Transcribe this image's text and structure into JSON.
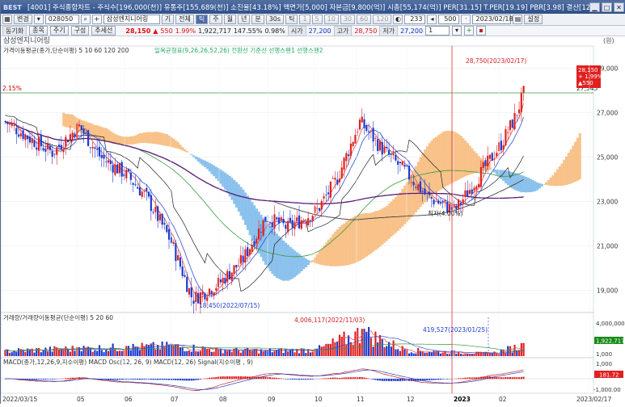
{
  "titlebar": {
    "logo": "BEST",
    "title": "[4001] 주식종합차트 - 주식수[196,000(천)] 유통주[155,689(천)] 소진율[43.18%] 액면가[5,000] 자본금[9,800(억)] 시총[55,174(억)] PER[31.15] T.PER[19.19] PBR[3.98] 결산[12월]"
  },
  "toolbar": {
    "market": "변경",
    "code": "028050",
    "name": "삼성엔지니어링",
    "period_buttons": [
      "기",
      "전체",
      "틱",
      "주",
      "월",
      "년",
      "분",
      "30s",
      "틱"
    ],
    "minute_buttons": [
      "1",
      "5",
      "10",
      "30",
      "60",
      "120"
    ],
    "count": "233",
    "max_count": "500",
    "date": "2023/02/18",
    "save": "설정"
  },
  "quotebar": {
    "sync": "동기화",
    "tabs": [
      "종목",
      "주기",
      "구성",
      "추세선"
    ],
    "name": "삼성엔지니어링",
    "price": "28,150",
    "arrow": "▲",
    "change": "550",
    "change_pct": "1.99%",
    "volume": "1,922,717",
    "vol_ratio": "147.55%",
    "turnover": "0.98%",
    "open_label": "시가",
    "open": "27,200",
    "high_label": "고가",
    "high": "28,750",
    "low_label": "저가",
    "low": "27,200",
    "page": "1"
  },
  "panels": {
    "price_title": "삼성엔지니어링",
    "price_unit": "(원)",
    "ma_legend": "가격이동평균(종가,단순이평) 5 10 60 120 200",
    "ichimoku_legend": "일목균형표(9,26,26,52,26) 전환선 기준선 선행스팬1 선행스팬2",
    "volume_legend": "거래량/거래량이동평균(단순이평) 5 20 60",
    "macd_legend": "MACD(종가,12,26,9,지수이평) MACD Osc(12, 26, 9) MACD(12, 26) Signal(지수이평 , 9)",
    "high_annotation": "28,750(2023/02/17)",
    "low_annotation": "18,450(2022/07/15)",
    "pct_annotation": "2.15%",
    "line_label": "27,545",
    "low_pct_annotation": "최저(4.00%)",
    "vol_high_annotation": "4,006,117(2022/11/03)",
    "vol_mid_annotation": "419,527(2023/01/25)",
    "price_tag": {
      "price": "28,150",
      "change": "+ 1.99%",
      "diff": "▲550"
    },
    "vol_tag": "1,922,717",
    "vol_axis": [
      "4,000,000",
      "1,000"
    ],
    "macd_tag": "181.72",
    "macd_axis": [
      "1,000",
      "-1,000.00"
    ],
    "price_axis": [
      "29,000",
      "27,000",
      "25,000",
      "23,000",
      "21,000",
      "19,000"
    ],
    "x_axis": [
      "2022/03/15",
      "05",
      "06",
      "07",
      "08",
      "09",
      "10",
      "11",
      "12",
      "2023",
      "02",
      "2023/02/17"
    ]
  },
  "chart_data": [
    {
      "type": "line",
      "title": "삼성엔지니어링",
      "ylabel": "(원)",
      "ylim": [
        18000,
        30000
      ],
      "series": [
        {
          "name": "종가",
          "x": [
            "2022/03/15",
            "2022/04/01",
            "2022/04/15",
            "2022/05/02",
            "2022/05/16",
            "2022/06/02",
            "2022/06/15",
            "2022/07/01",
            "2022/07/15",
            "2022/08/01",
            "2022/08/16",
            "2022/09/01",
            "2022/09/15",
            "2022/10/04",
            "2022/10/17",
            "2022/11/01",
            "2022/11/15",
            "2022/12/01",
            "2022/12/15",
            "2023/01/02",
            "2023/01/16",
            "2023/02/01",
            "2023/02/10",
            "2023/02/17"
          ],
          "values": [
            26600,
            25800,
            25200,
            26400,
            25000,
            24200,
            23200,
            21200,
            18600,
            19300,
            20300,
            22300,
            21800,
            22600,
            24000,
            26600,
            25400,
            24300,
            23200,
            22600,
            24000,
            25600,
            26800,
            28150
          ]
        }
      ]
    },
    {
      "type": "bar",
      "title": "거래량",
      "ylim": [
        0,
        4500000
      ],
      "x": [
        "2022/03/15",
        "2022/05/02",
        "2022/06/02",
        "2022/07/01",
        "2022/08/01",
        "2022/09/01",
        "2022/10/04",
        "2022/11/03",
        "2022/12/01",
        "2023/01/25",
        "2023/02/17"
      ],
      "values": [
        900000,
        1300000,
        1500000,
        1700000,
        1100000,
        900000,
        1100000,
        4006117,
        1000000,
        419527,
        1922717
      ]
    }
  ]
}
